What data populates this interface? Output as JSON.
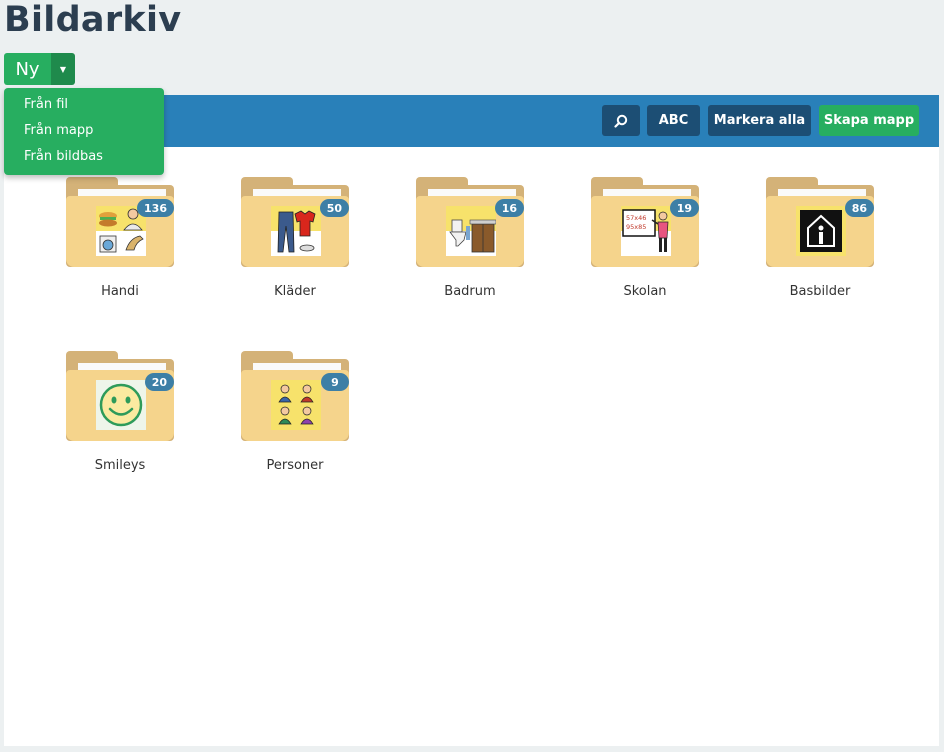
{
  "page": {
    "title": "Bildarkiv"
  },
  "new_button": {
    "label": "Ny",
    "menu": [
      {
        "label": "Från fil"
      },
      {
        "label": "Från mapp"
      },
      {
        "label": "Från bildbas"
      }
    ]
  },
  "toolbar": {
    "search_icon": "search-icon",
    "abc_label": "ABC",
    "select_all_label": "Markera alla",
    "create_folder_label": "Skapa mapp"
  },
  "folders": [
    {
      "name": "Handi",
      "count": "136"
    },
    {
      "name": "Kläder",
      "count": "50"
    },
    {
      "name": "Badrum",
      "count": "16"
    },
    {
      "name": "Skolan",
      "count": "19"
    },
    {
      "name": "Basbilder",
      "count": "86"
    },
    {
      "name": "Smileys",
      "count": "20"
    },
    {
      "name": "Personer",
      "count": "9"
    }
  ],
  "thumbnails": {
    "skolan_board_text_1": "57x46",
    "skolan_board_text_2": "95x85"
  },
  "colors": {
    "page_bg": "#ecf0f1",
    "title": "#2c3e50",
    "primary_green": "#27ae60",
    "header_blue": "#2980b9",
    "dark_button": "#1c4e74",
    "badge": "#3d7fa6",
    "folder_back": "#d4b278",
    "folder_front": "#f5d48c"
  }
}
